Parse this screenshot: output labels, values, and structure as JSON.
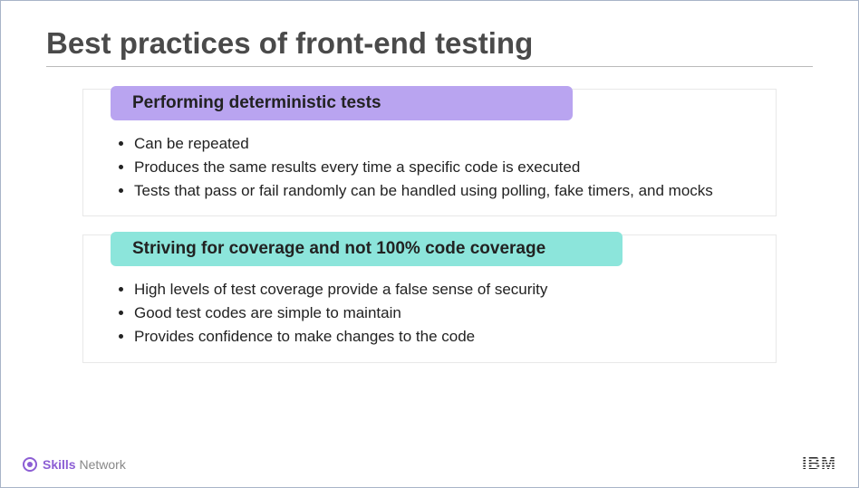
{
  "title": "Best practices of front-end testing",
  "sections": [
    {
      "heading": "Performing deterministic tests",
      "color": "purple",
      "bullets": [
        "Can be repeated",
        "Produces the same results every time a specific code is executed",
        "Tests that pass or fail randomly can be handled using polling, fake timers, and mocks"
      ]
    },
    {
      "heading": "Striving for coverage and not 100% code coverage",
      "color": "teal",
      "bullets": [
        "High levels of test coverage provide a false sense of security",
        "Good test codes are simple to maintain",
        "Provides confidence to make changes to the code"
      ]
    }
  ],
  "footer": {
    "brand_bold": "Skills",
    "brand_light": " Network",
    "logo": "IBM"
  }
}
